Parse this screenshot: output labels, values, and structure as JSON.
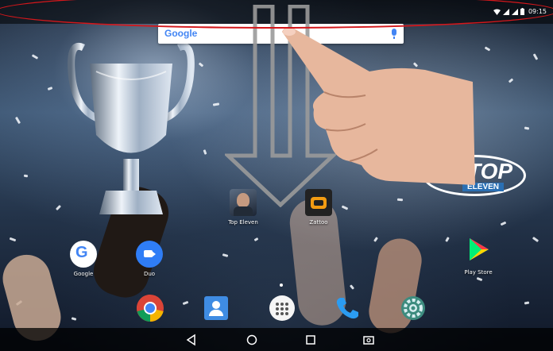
{
  "status_bar": {
    "time": "09:15"
  },
  "search_widget": {
    "logo_text": "Google"
  },
  "wallpaper": {
    "logo_top": "TOP",
    "logo_eleven": "ELEVEN"
  },
  "home_apps": [
    {
      "label": "Top Eleven",
      "icon": "top-eleven-icon"
    },
    {
      "label": "Zattoo",
      "icon": "zattoo-icon"
    },
    {
      "label": "Google",
      "icon": "google-icon"
    },
    {
      "label": "Duo",
      "icon": "duo-icon"
    },
    {
      "label": "Play Store",
      "icon": "play-store-icon"
    }
  ],
  "dock": [
    {
      "icon": "chrome-icon"
    },
    {
      "icon": "contacts-icon"
    },
    {
      "icon": "app-drawer-icon"
    },
    {
      "icon": "phone-icon"
    },
    {
      "icon": "settings-icon"
    }
  ],
  "nav_bar": [
    "back-icon",
    "home-icon",
    "recents-icon",
    "screenshot-icon"
  ],
  "colors": {
    "annotation_red": "#d3171b",
    "google_blue": "#4285f4"
  }
}
